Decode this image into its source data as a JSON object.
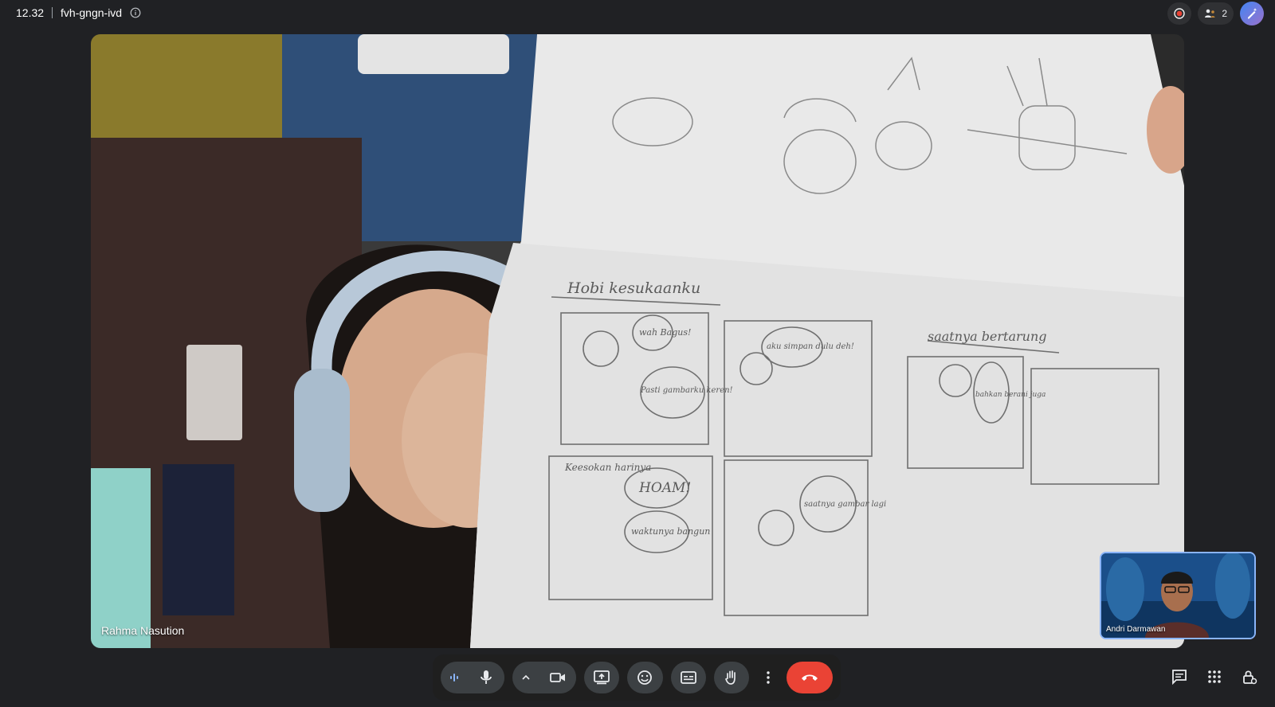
{
  "header": {
    "time": "12.32",
    "meeting_code": "fvh-gngn-ivd",
    "info_icon": "info-icon",
    "participant_count": "2"
  },
  "main_video": {
    "participant_name": "Rahma Nasution"
  },
  "self_view": {
    "participant_name": "Andri Darmawan"
  },
  "drawing_text": {
    "comic_title": "Hobi kesukaanku",
    "bubble_1": "wah Bagus!",
    "bubble_2": "Pasti gambarku keren!",
    "bubble_3": "aku simpan dulu deh!",
    "caption_2": "Keesokan harinya",
    "bubble_4": "HOAM!",
    "bubble_5": "waktunya bangun",
    "bubble_6": "saatnya gambar lagi",
    "side_title": "saatnya bertarung",
    "bubble_7": "bahkan berani juga"
  },
  "controls": {
    "buttons": [
      "audio-level-icon",
      "microphone-icon",
      "chevron-up-icon",
      "camera-icon",
      "present-screen-icon",
      "emoji-icon",
      "captions-icon",
      "raise-hand-icon",
      "more-options-icon",
      "hang-up-icon"
    ],
    "right_tools": [
      "chat-icon",
      "activities-icon",
      "host-controls-icon"
    ]
  },
  "colors": {
    "background": "#202124",
    "hangup": "#ea4335",
    "control_bg": "#3c4043",
    "self_view_border": "#8ab4f8"
  }
}
